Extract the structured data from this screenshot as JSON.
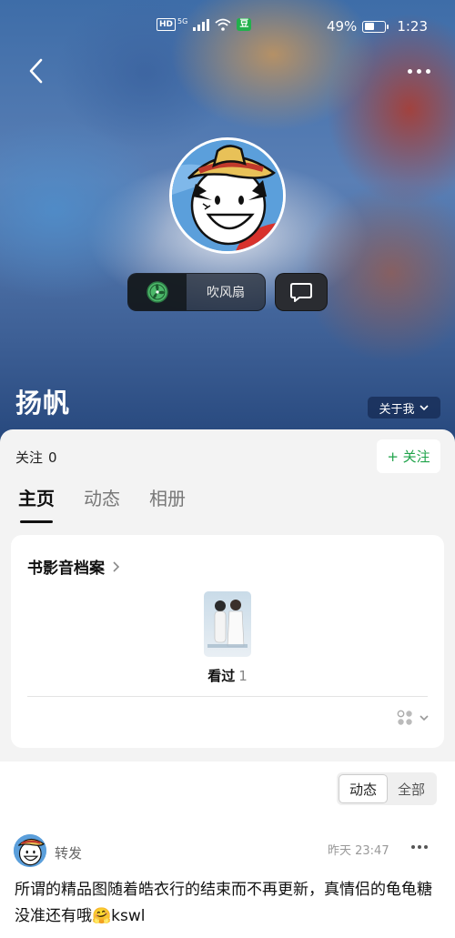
{
  "status_bar": {
    "hd": "HD",
    "network": "5G",
    "app_badge": "豆",
    "battery": "49%",
    "battery_level": 0.49,
    "time": "1:23"
  },
  "profile": {
    "name": "扬帆",
    "status_label": "吹风扇",
    "about_label": "关于我"
  },
  "follow": {
    "label": "关注",
    "count": "0",
    "button": "+ 关注"
  },
  "tabs": [
    {
      "label": "主页",
      "active": true
    },
    {
      "label": "动态",
      "active": false
    },
    {
      "label": "相册",
      "active": false
    }
  ],
  "archive": {
    "title": "书影音档案",
    "watched_label": "看过",
    "watched_count": "1"
  },
  "feed": {
    "filters": [
      {
        "label": "动态",
        "active": true
      },
      {
        "label": "全部",
        "active": false
      }
    ],
    "post": {
      "action": "转发",
      "time": "昨天 23:47",
      "text": "所谓的精品图随着皓衣行的结束而不再更新，真情侣的龟龟糖没准还有哦🤗kswl"
    }
  },
  "colors": {
    "accent_green": "#1fa34a"
  }
}
